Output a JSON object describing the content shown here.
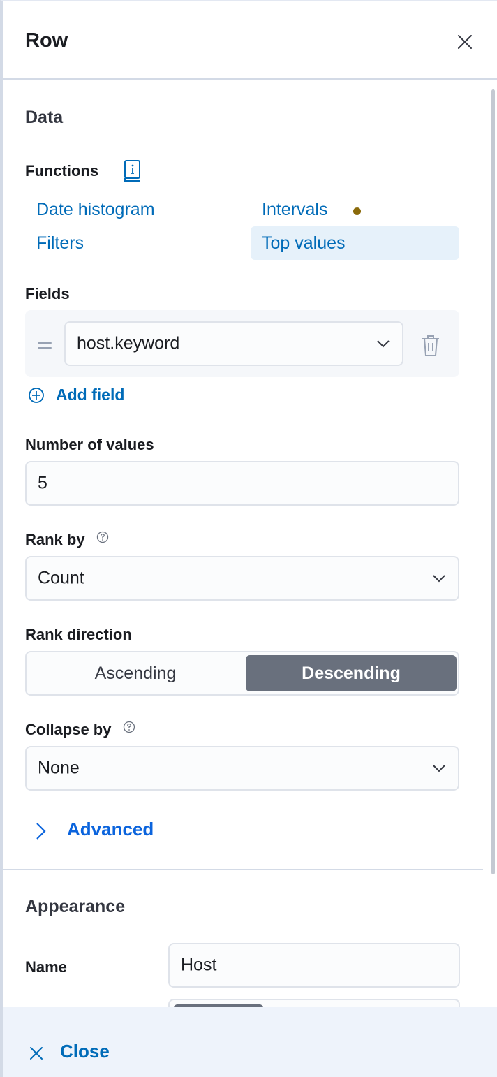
{
  "flyout": {
    "title": "Row"
  },
  "data_section": {
    "heading": "Data",
    "functions_label": "Functions",
    "functions": [
      {
        "label": "Date histogram",
        "selected": false
      },
      {
        "label": "Intervals",
        "selected": false,
        "indicator": true
      },
      {
        "label": "Filters",
        "selected": false
      },
      {
        "label": "Top values",
        "selected": true
      }
    ],
    "fields_label": "Fields",
    "field_value": "host.keyword",
    "add_field_label": "Add field",
    "number_of_values_label": "Number of values",
    "number_of_values": "5",
    "rank_by_label": "Rank by",
    "rank_by_value": "Count",
    "rank_direction_label": "Rank direction",
    "rank_direction_options": [
      "Ascending",
      "Descending"
    ],
    "rank_direction_selected": "Descending",
    "collapse_by_label": "Collapse by",
    "collapse_by_value": "None",
    "advanced_label": "Advanced"
  },
  "appearance_section": {
    "heading": "Appearance",
    "name_label": "Name",
    "name_value": "Host"
  },
  "footer": {
    "close_label": "Close"
  },
  "colors": {
    "link": "#006bb8",
    "selected_function_bg": "#e6f1fa",
    "interval_indicator": "#8a6a0a",
    "toggle_selected_bg": "#69707d",
    "footer_bg": "#eef3fb"
  }
}
